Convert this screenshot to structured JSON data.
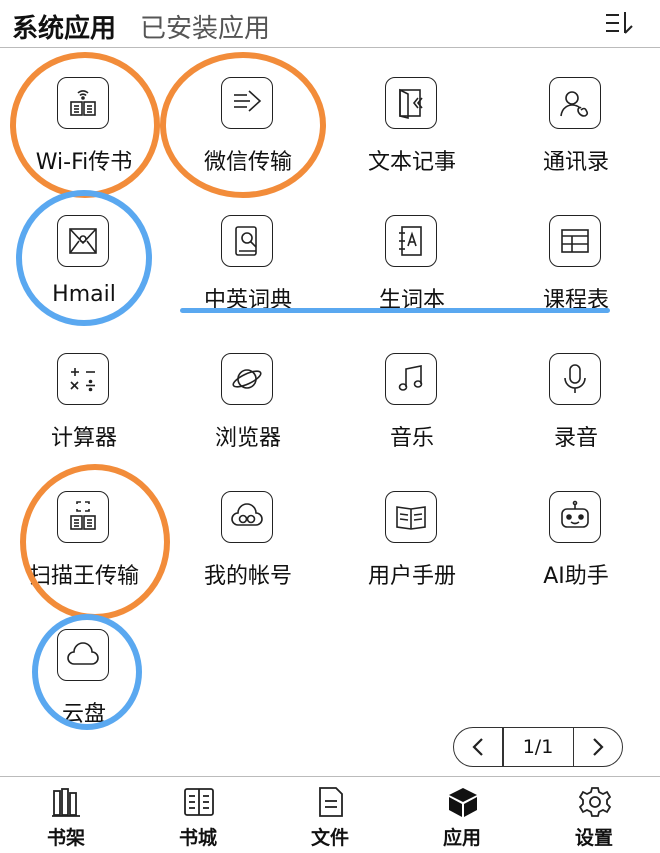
{
  "header": {
    "tab_active": "系统应用",
    "tab_inactive": "已安装应用"
  },
  "apps": [
    {
      "label": "Wi-Fi传书",
      "icon": "wifi-book-icon"
    },
    {
      "label": "微信传输",
      "icon": "wechat-transfer-icon"
    },
    {
      "label": "文本记事",
      "icon": "notes-icon"
    },
    {
      "label": "通讯录",
      "icon": "contacts-icon"
    },
    {
      "label": "Hmail",
      "icon": "mail-icon"
    },
    {
      "label": "中英词典",
      "icon": "dictionary-icon"
    },
    {
      "label": "生词本",
      "icon": "vocabulary-book-icon"
    },
    {
      "label": "课程表",
      "icon": "timetable-icon"
    },
    {
      "label": "计算器",
      "icon": "calculator-icon"
    },
    {
      "label": "浏览器",
      "icon": "browser-planet-icon"
    },
    {
      "label": "音乐",
      "icon": "music-note-icon"
    },
    {
      "label": "录音",
      "icon": "microphone-icon"
    },
    {
      "label": "扫描王传输",
      "icon": "scan-transfer-icon"
    },
    {
      "label": "我的帐号",
      "icon": "cloud-account-icon"
    },
    {
      "label": "用户手册",
      "icon": "manual-book-icon"
    },
    {
      "label": "AI助手",
      "icon": "robot-icon"
    },
    {
      "label": "云盘",
      "icon": "cloud-drive-icon"
    }
  ],
  "pager": {
    "text": "1/1"
  },
  "bottom_nav": [
    {
      "label": "书架",
      "icon": "bookshelf-icon"
    },
    {
      "label": "书城",
      "icon": "bookstore-icon"
    },
    {
      "label": "文件",
      "icon": "file-icon"
    },
    {
      "label": "应用",
      "icon": "apps-cube-icon",
      "active": true
    },
    {
      "label": "设置",
      "icon": "gear-icon"
    }
  ],
  "annotation_colors": {
    "orange": "#f28c3a",
    "blue": "#5aa8f0"
  }
}
